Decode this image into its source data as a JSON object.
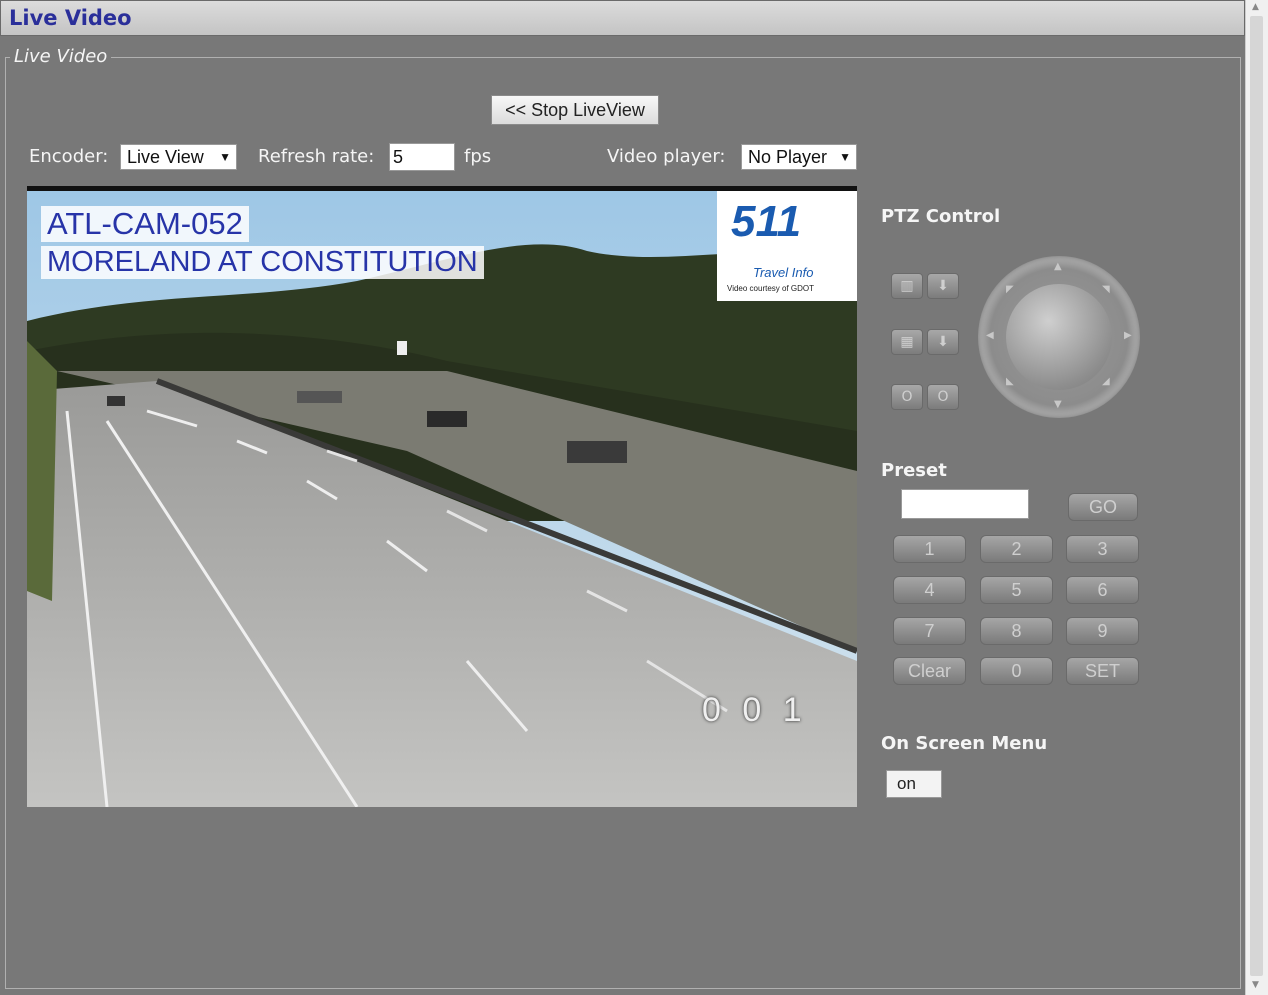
{
  "window": {
    "title": "Live Video"
  },
  "panel": {
    "legend": "Live Video"
  },
  "toolbar": {
    "stop_label": "<< Stop LiveView",
    "encoder_label": "Encoder:",
    "encoder_value": "Live View",
    "refresh_label": "Refresh rate:",
    "refresh_value": "5",
    "refresh_unit": "fps",
    "player_label": "Video player:",
    "player_value": "No Player"
  },
  "video": {
    "camera_id": "ATL-CAM-052",
    "location": "MORELAND AT CONSTITUTION",
    "logo_number": "511",
    "logo_text": "Travel Info",
    "logo_credit": "Video courtesy of GDOT",
    "counter": "0 0 1"
  },
  "ptz": {
    "title": "PTZ Control",
    "buttons": [
      "zoom-out",
      "focus-near",
      "zoom-in",
      "focus-far",
      "iris-close",
      "iris-open"
    ]
  },
  "preset": {
    "title": "Preset",
    "input_value": "",
    "go_label": "GO",
    "keys": [
      "1",
      "2",
      "3",
      "4",
      "5",
      "6",
      "7",
      "8",
      "9",
      "Clear",
      "0",
      "SET"
    ]
  },
  "osm": {
    "title": "On Screen Menu",
    "button_label": "on"
  },
  "colors": {
    "background": "#787878",
    "title_text": "#2a2f9a",
    "overlay_text": "#2734a8"
  }
}
